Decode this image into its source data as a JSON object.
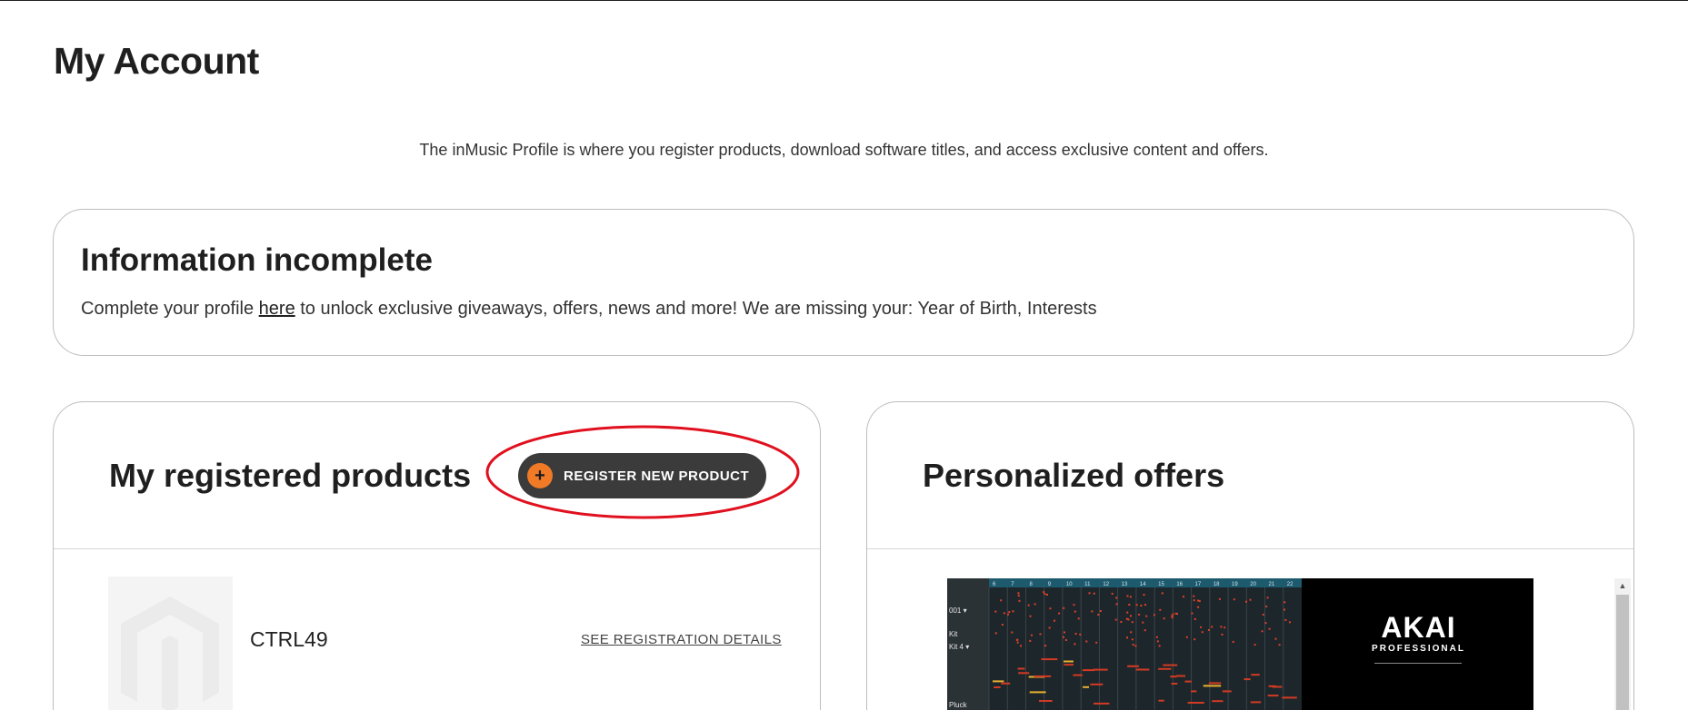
{
  "page": {
    "title": "My Account",
    "intro": "The inMusic Profile is where you register products, download software titles, and access exclusive content and offers."
  },
  "info_card": {
    "title": "Information incomplete",
    "text_before": "Complete your profile ",
    "link_label": "here",
    "text_after": " to unlock exclusive giveaways, offers, news and more! We are missing your: Year of Birth, Interests"
  },
  "products": {
    "heading": "My registered products",
    "register_button": {
      "icon": "plus-icon",
      "symbol": "+",
      "label": "REGISTER NEW PRODUCT"
    },
    "items": [
      {
        "name": "CTRL49",
        "details_link": "SEE REGISTRATION DETAILS",
        "thumb_icon": "magento-logo-icon"
      }
    ]
  },
  "offers": {
    "heading": "Personalized offers",
    "banner": {
      "brand": "AKAI",
      "brand_sub": "PROFESSIONAL",
      "ruler_numbers": [
        "6",
        "7",
        "8",
        "9",
        "10",
        "11",
        "12",
        "13",
        "14",
        "15",
        "16",
        "17",
        "18",
        "19",
        "20",
        "21",
        "22"
      ],
      "track_labels": [
        "001 ▾",
        "Kit",
        "Kit 4 ▾",
        "Pluck"
      ]
    }
  },
  "colors": {
    "accent_orange": "#f07a26",
    "button_dark": "#3b3b3b",
    "annotation_red": "#e0101e"
  }
}
